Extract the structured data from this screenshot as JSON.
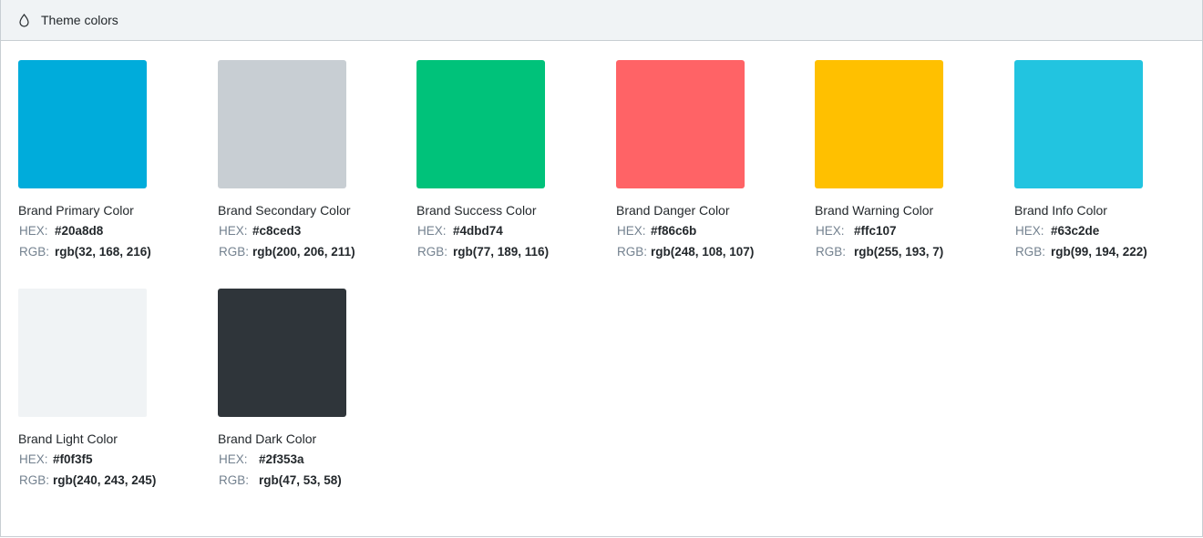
{
  "header": {
    "title": "Theme colors",
    "icon": "drop-icon"
  },
  "labels": {
    "hex": "HEX:",
    "rgb": "RGB:"
  },
  "swatches": [
    {
      "name": "Brand Primary Color",
      "hex": "#20a8d8",
      "rgb": "rgb(32, 168, 216)",
      "color": "#00acdb"
    },
    {
      "name": "Brand Secondary Color",
      "hex": "#c8ced3",
      "rgb": "rgb(200, 206, 211)",
      "color": "#c8ced3"
    },
    {
      "name": "Brand Success Color",
      "hex": "#4dbd74",
      "rgb": "rgb(77, 189, 116)",
      "color": "#00c27a"
    },
    {
      "name": "Brand Danger Color",
      "hex": "#f86c6b",
      "rgb": "rgb(248, 108, 107)",
      "color": "#ff6366"
    },
    {
      "name": "Brand Warning Color",
      "hex": "#ffc107",
      "rgb": "rgb(255, 193, 7)",
      "color": "#ffc000"
    },
    {
      "name": "Brand Info Color",
      "hex": "#63c2de",
      "rgb": "rgb(99, 194, 222)",
      "color": "#22c4e0"
    },
    {
      "name": "Brand Light Color",
      "hex": "#f0f3f5",
      "rgb": "rgb(240, 243, 245)",
      "color": "#f0f3f5"
    },
    {
      "name": "Brand Dark Color",
      "hex": "#2f353a",
      "rgb": "rgb(47, 53, 58)",
      "color": "#2f353a"
    }
  ]
}
